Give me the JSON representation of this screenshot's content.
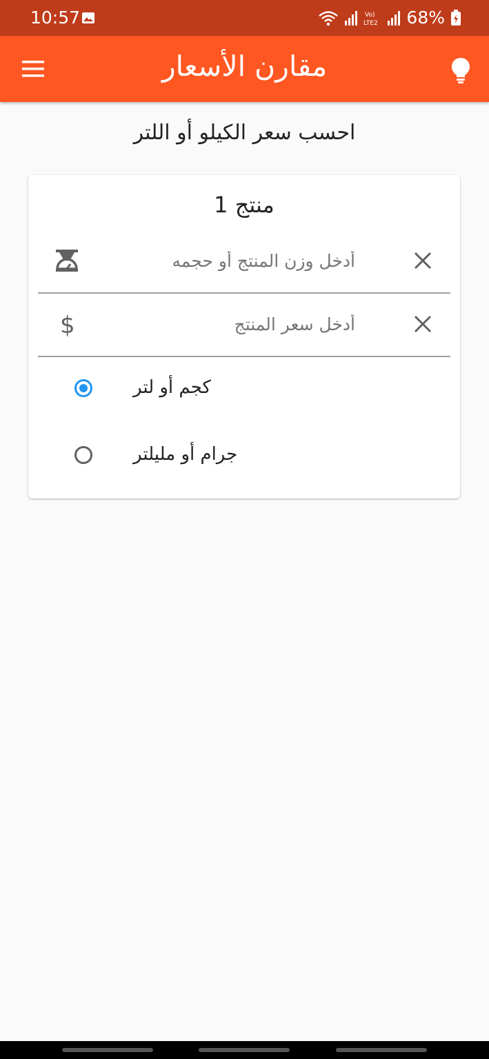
{
  "status_bar": {
    "time": "10:57",
    "battery_text": "68%",
    "icons": [
      "image-icon",
      "wifi-icon",
      "signal-icon",
      "volte-icon",
      "signal-icon",
      "battery-icon"
    ]
  },
  "app_bar": {
    "title": "مقارن الأسعار",
    "background": "#ff5722",
    "menu_icon": "menu-icon",
    "tips_icon": "lightbulb-icon"
  },
  "page": {
    "heading": "احسب سعر الكيلو أو اللتر"
  },
  "product_card": {
    "title": "منتج 1",
    "weight_field": {
      "placeholder": "أدخل وزن المنتج أو حجمه",
      "value": "",
      "prefix_icon": "scale-icon",
      "clear_icon": "close-icon"
    },
    "price_field": {
      "placeholder": "أدخل سعر المنتج",
      "value": "",
      "prefix_icon": "dollar-icon",
      "clear_icon": "close-icon"
    },
    "unit_options": [
      {
        "label": "كجم أو لتر",
        "selected": true
      },
      {
        "label": "جرام أو مليلتر",
        "selected": false
      }
    ],
    "accent": "#2196f3"
  }
}
